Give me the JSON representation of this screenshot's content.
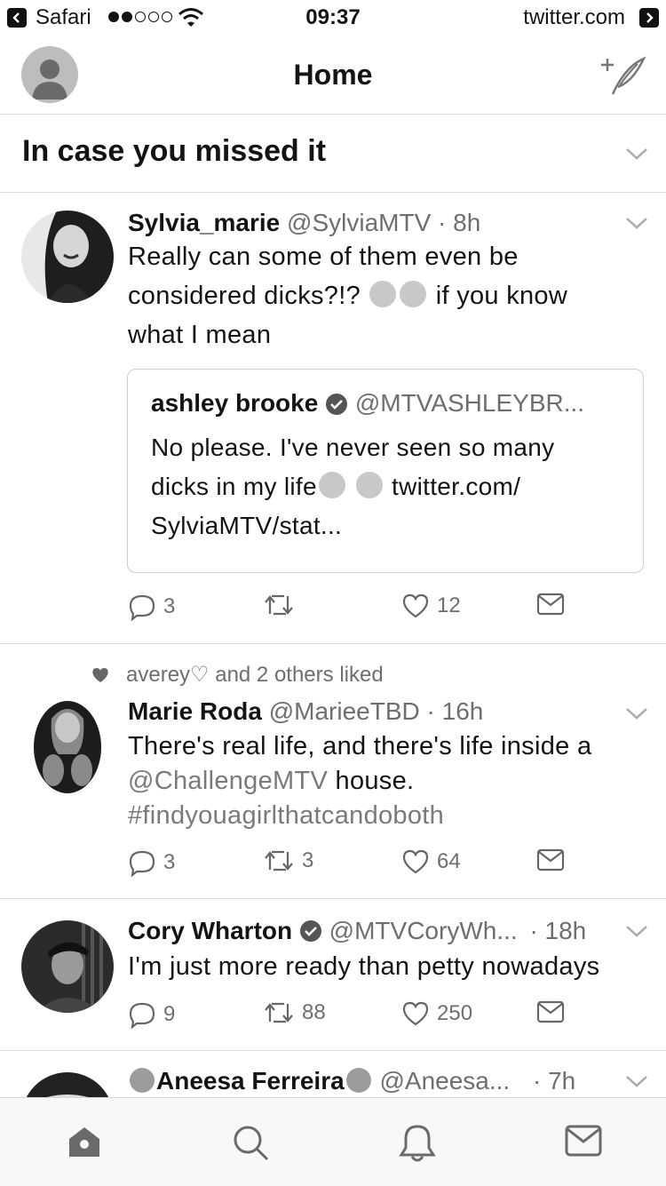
{
  "status_bar": {
    "app": "Safari",
    "time": "09:37",
    "url": "twitter.com"
  },
  "header": {
    "title": "Home"
  },
  "section": {
    "title": "In case you missed it"
  },
  "tweets": [
    {
      "name": "Sylvia_marie",
      "handle": "@SylviaMTV",
      "time": "· 8h",
      "lines": [
        "Really can some of them even be",
        "considered dicks?!?",
        "if you know",
        "what I mean"
      ],
      "quote": {
        "name": "ashley brooke",
        "handle": "@MTVASHLEYBR...",
        "lines": [
          "No please. I've never seen so many",
          "dicks in my life",
          "twitter.com/",
          "SylviaMTV/stat..."
        ]
      },
      "replies": "3",
      "retweets": "",
      "likes": "12"
    },
    {
      "social": "averey♡ and 2 others liked",
      "name": "Marie Roda",
      "handle": "@MarieeTBD",
      "time": "· 16h",
      "lines": [
        "There's real life, and there's life inside a",
        "@ChallengeMTV",
        "house.",
        "#findyouagirlthatcandoboth"
      ],
      "replies": "3",
      "retweets": "3",
      "likes": "64"
    },
    {
      "name": "Cory Wharton",
      "handle": "@MTVCoryWh...",
      "time": "· 18h",
      "lines": [
        "I'm just more ready than petty nowadays"
      ],
      "replies": "9",
      "retweets": "88",
      "likes": "250"
    },
    {
      "name": "Aneesa Ferreira",
      "handle": "@Aneesa...",
      "time": "· 7h"
    }
  ],
  "tabs": [
    "home-icon",
    "search-icon",
    "bell-icon",
    "mail-icon"
  ]
}
